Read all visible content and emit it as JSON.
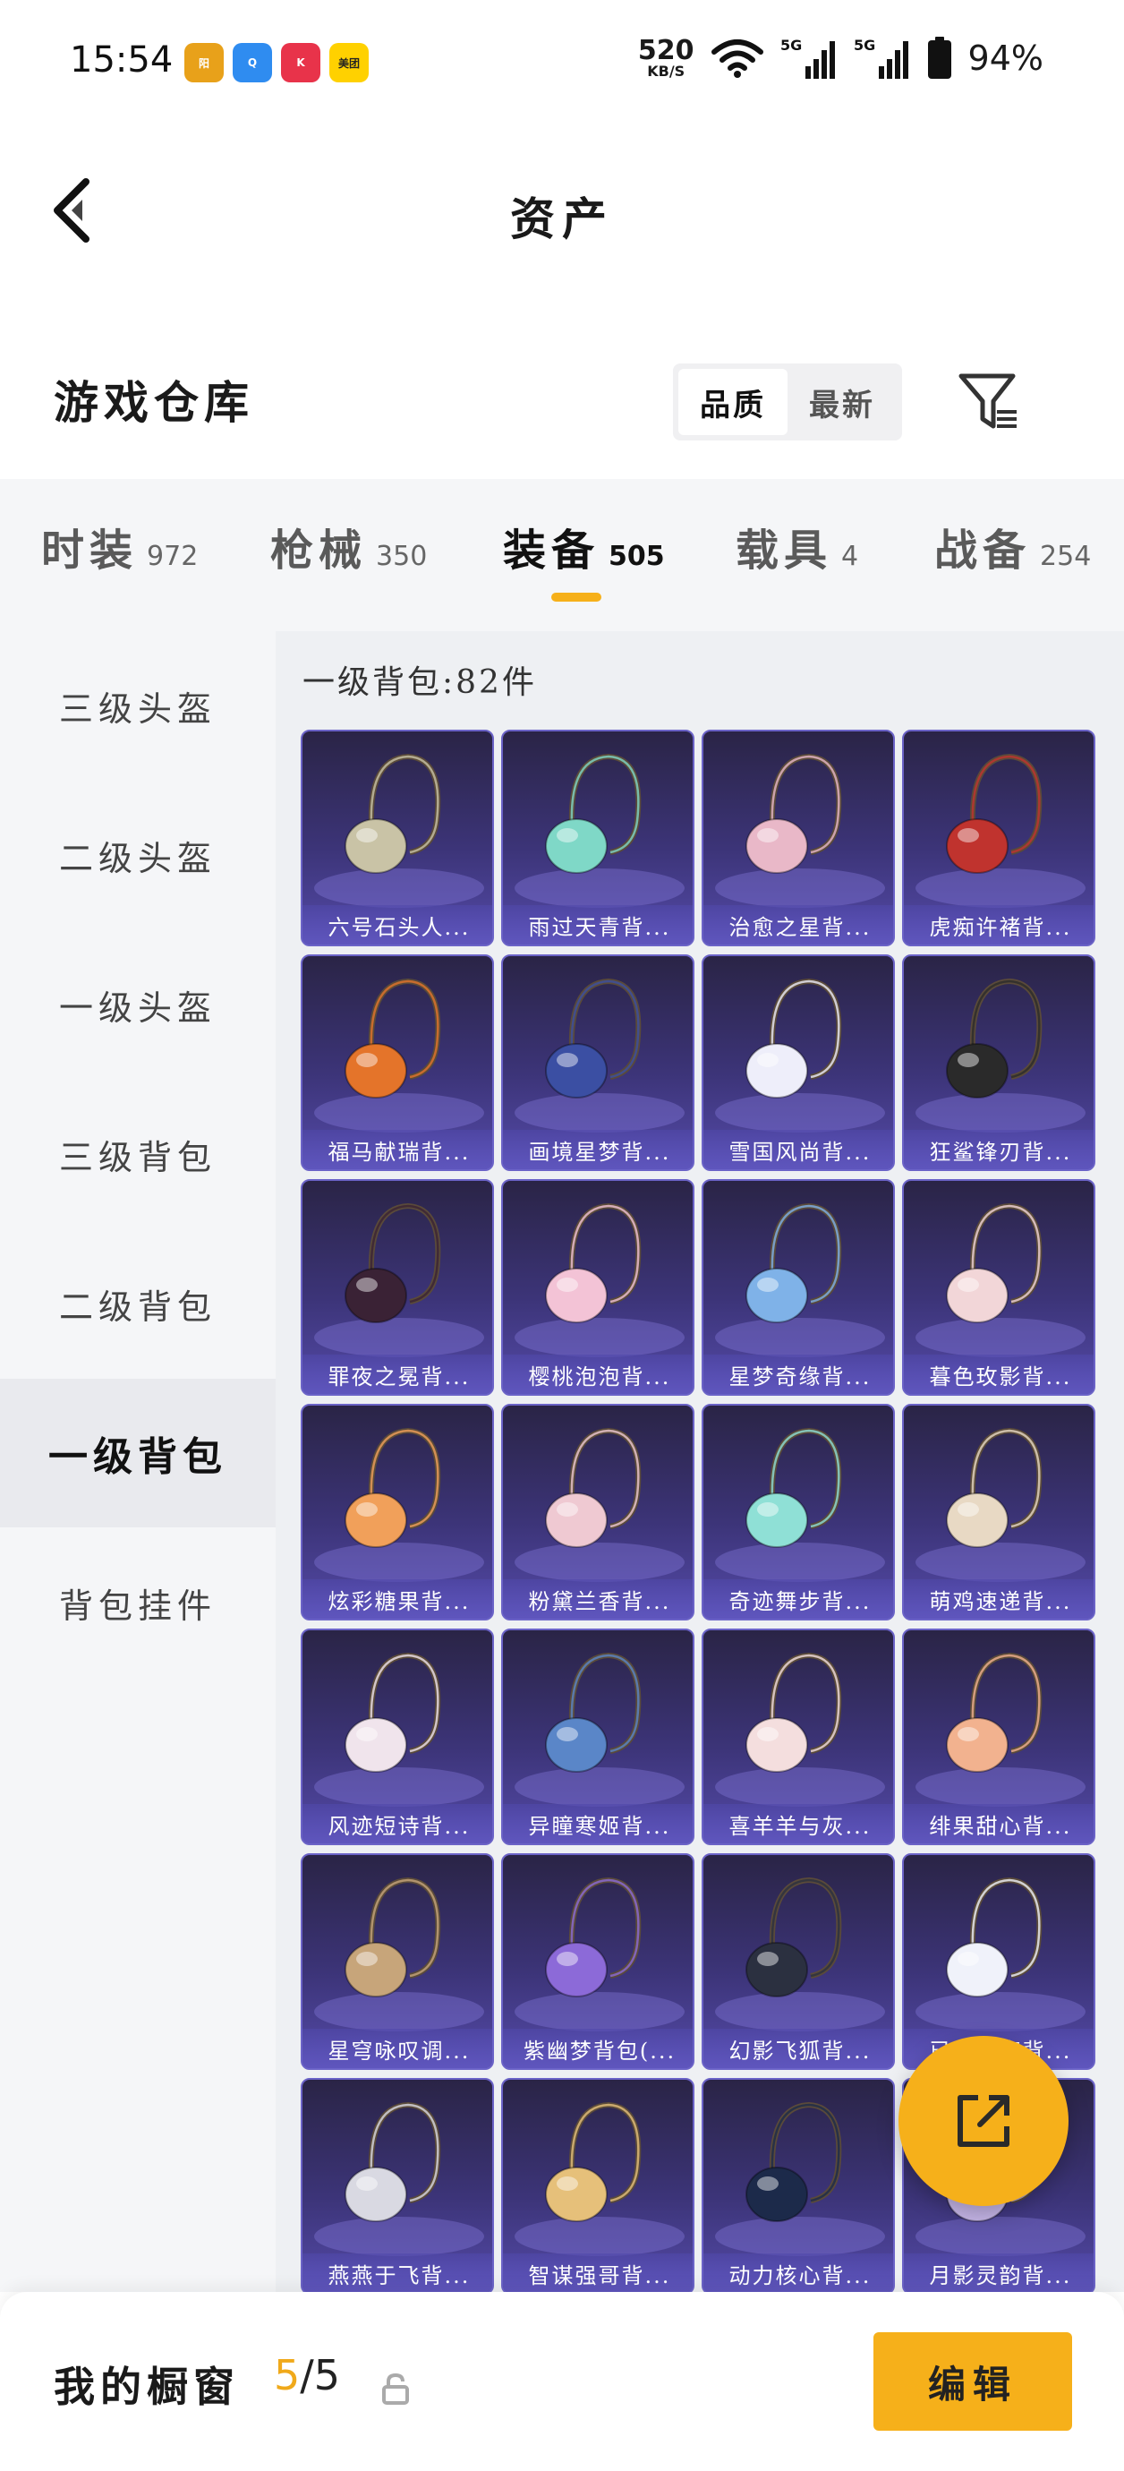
{
  "status_bar": {
    "time": "15:54",
    "apps": [
      {
        "name": "app-1",
        "label": "阳",
        "color": "#e8a11a"
      },
      {
        "name": "app-2",
        "label": "Q",
        "color": "#2f8cf0"
      },
      {
        "name": "app-3",
        "label": "K",
        "color": "#e8334a"
      },
      {
        "name": "app-4",
        "label": "美团",
        "color": "#ffd100"
      }
    ],
    "net_speed": "520",
    "net_unit": "KB/S",
    "battery": "94%"
  },
  "header": {
    "title": "资产"
  },
  "section": {
    "title": "游戏仓库",
    "sort_options": [
      "品质",
      "最新"
    ],
    "sort_active_index": 0
  },
  "tabs": [
    {
      "label": "时装",
      "count": "972"
    },
    {
      "label": "枪械",
      "count": "350"
    },
    {
      "label": "装备",
      "count": "505"
    },
    {
      "label": "载具",
      "count": "4"
    },
    {
      "label": "战备",
      "count": "254"
    }
  ],
  "tab_active_index": 2,
  "sidebar": [
    {
      "label": "三级头盔"
    },
    {
      "label": "二级头盔"
    },
    {
      "label": "一级头盔"
    },
    {
      "label": "三级背包"
    },
    {
      "label": "二级背包"
    },
    {
      "label": "一级背包"
    },
    {
      "label": "背包挂件"
    }
  ],
  "sidebar_active_index": 5,
  "content": {
    "count_label": "一级背包:82件",
    "items": [
      {
        "name": "六号石头人...",
        "color": "#c9c3a6"
      },
      {
        "name": "雨过天青背...",
        "color": "#7fd8c7"
      },
      {
        "name": "治愈之星背...",
        "color": "#e9b8c8"
      },
      {
        "name": "虎痴许褚背...",
        "color": "#c0332e"
      },
      {
        "name": "福马献瑞背...",
        "color": "#e4742a"
      },
      {
        "name": "画境星梦背...",
        "color": "#3b4fa3"
      },
      {
        "name": "雪国风尚背...",
        "color": "#eeeefa"
      },
      {
        "name": "狂鲨锋刃背...",
        "color": "#2a2a2a"
      },
      {
        "name": "罪夜之冕背...",
        "color": "#3a2235"
      },
      {
        "name": "樱桃泡泡背...",
        "color": "#f3c3d6"
      },
      {
        "name": "星梦奇缘背...",
        "color": "#7fb2e8"
      },
      {
        "name": "暮色玫影背...",
        "color": "#f2d6d8"
      },
      {
        "name": "炫彩糖果背...",
        "color": "#f1a05a"
      },
      {
        "name": "粉黛兰香背...",
        "color": "#efc9d2"
      },
      {
        "name": "奇迹舞步背...",
        "color": "#8fe0d6"
      },
      {
        "name": "萌鸡速递背...",
        "color": "#e8d9c4"
      },
      {
        "name": "风迹短诗背...",
        "color": "#f0e4ec"
      },
      {
        "name": "异瞳寒姬背...",
        "color": "#5a86c8"
      },
      {
        "name": "喜羊羊与灰...",
        "color": "#f4dede"
      },
      {
        "name": "绯果甜心背...",
        "color": "#f2b28f"
      },
      {
        "name": "星穹咏叹调...",
        "color": "#c7a57a"
      },
      {
        "name": "紫幽梦背包(...",
        "color": "#8c6ad8"
      },
      {
        "name": "幻影飞狐背...",
        "color": "#2b3040"
      },
      {
        "name": "已是光亮背...",
        "color": "#f0f2fa"
      },
      {
        "name": "燕燕于飞背...",
        "color": "#d9d9e2"
      },
      {
        "name": "智谋强哥背...",
        "color": "#e6c07a"
      },
      {
        "name": "动力核心背...",
        "color": "#1c2a4a"
      },
      {
        "name": "月影灵韵背...",
        "color": "#c6b6e8"
      }
    ]
  },
  "bottom_bar": {
    "label": "我的橱窗",
    "current": "5",
    "separator": "/",
    "max": "5",
    "edit_label": "编辑"
  },
  "accent_color": "#f6b01a"
}
